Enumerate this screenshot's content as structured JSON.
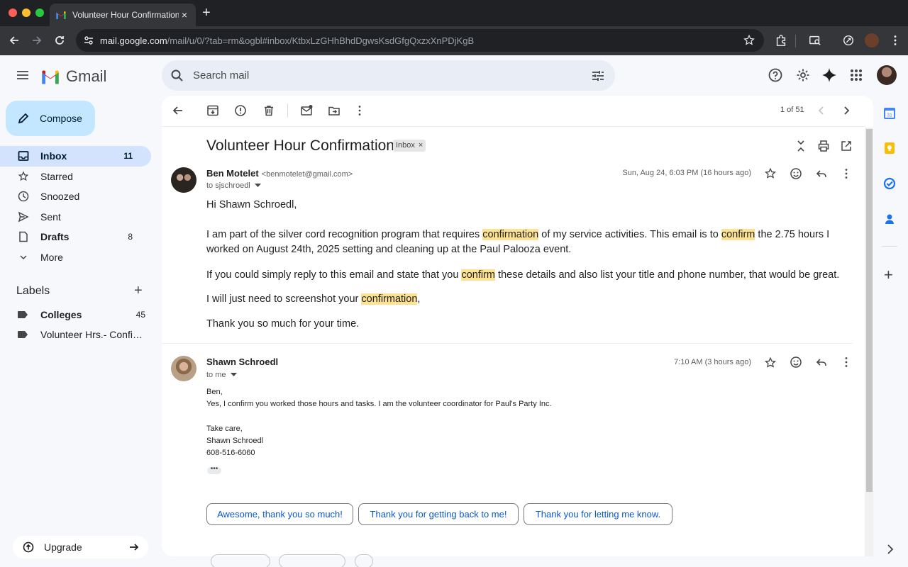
{
  "browser": {
    "tab_title": "Volunteer Hour Confirmation",
    "tab_close": "×",
    "new_tab": "+",
    "url_host": "mail.google.com",
    "url_path": "/mail/u/0/?tab=rm&ogbl#inbox/KtbxLzGHhBhdDgwsKsdGfgQxzxXnPDjKgB"
  },
  "header": {
    "app_name": "Gmail",
    "search_placeholder": "Search mail"
  },
  "compose_label": "Compose",
  "nav": [
    {
      "label": "Inbox",
      "count": "11",
      "icon": "inbox-icon"
    },
    {
      "label": "Starred",
      "count": "",
      "icon": "star-icon"
    },
    {
      "label": "Snoozed",
      "count": "",
      "icon": "clock-icon"
    },
    {
      "label": "Sent",
      "count": "",
      "icon": "send-icon"
    },
    {
      "label": "Drafts",
      "count": "8",
      "icon": "draft-icon"
    },
    {
      "label": "More",
      "count": "",
      "icon": "chevron-down-icon"
    }
  ],
  "labels": {
    "title": "Labels",
    "add": "+",
    "items": [
      {
        "name": "Colleges",
        "count": "45"
      },
      {
        "name": "Volunteer Hrs.- Confirm...",
        "count": ""
      }
    ]
  },
  "upgrade_label": "Upgrade",
  "thread": {
    "pager": "1 of 51",
    "subject": "Volunteer Hour Confirmation",
    "chip_label": "Inbox",
    "chip_close": "×",
    "messages": [
      {
        "sender": "Ben Motelet",
        "email": "<benmotelet@gmail.com>",
        "to": "to sjschroedl",
        "date": "Sun, Aug 24, 6:03 PM (16 hours ago)",
        "greeting": "Hi Shawn Schroedl,",
        "p1_a": "I am part of the silver cord recognition program that requires ",
        "p1_hl1": "confirmation",
        "p1_b": " of my service activities. This email is to ",
        "p1_hl2": "confirm",
        "p1_c": " the 2.75 hours I worked on August 24th, 2025 setting and cleaning up at the Paul Palooza event.",
        "p2_a": "If you could simply reply to this email and state that you ",
        "p2_hl": "confirm",
        "p2_b": " these details and also list your title and phone number, that would be great.",
        "p3_a": "I will just need to screenshot your ",
        "p3_hl": "confirmation",
        "p3_b": ",",
        "p4": "Thank you so much for your time."
      },
      {
        "sender": "Shawn Schroedl",
        "to": "to me",
        "date": "7:10 AM (3 hours ago)",
        "lines": [
          "Ben,",
          "Yes, I confirm you worked those hours and tasks. I am the volunteer coordinator for Paul's Party Inc.",
          "Take care,",
          "Shawn Schroedl",
          "608-516-6060"
        ],
        "more": "•••"
      }
    ],
    "smart_replies": [
      "Awesome, thank you so much!",
      "Thank you for getting back to me!",
      "Thank you for letting me know."
    ]
  },
  "colors": {
    "accent": "#0b57d0",
    "compose_bg": "#c2e7ff",
    "active_nav": "#d3e3fd",
    "highlight": "#fde293"
  }
}
